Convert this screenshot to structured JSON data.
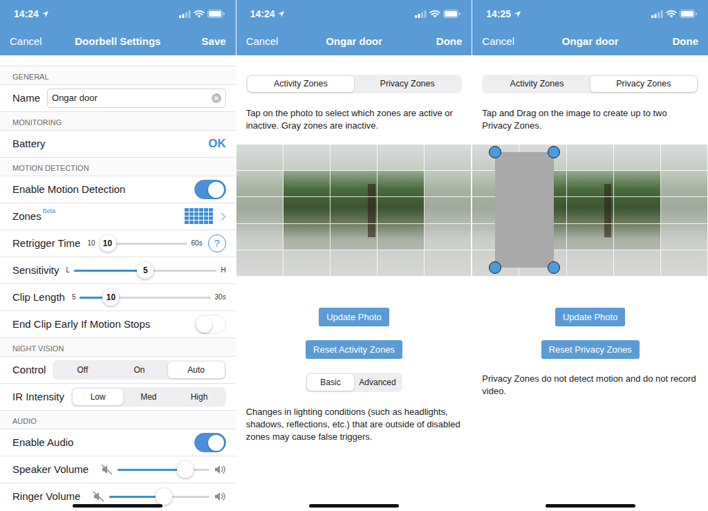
{
  "screens": [
    {
      "status_bar": {
        "time": "14:24"
      },
      "nav": {
        "left": "Cancel",
        "title": "Doorbell Settings",
        "right": "Save"
      },
      "sections": [
        {
          "header": "GENERAL",
          "rows": [
            {
              "kind": "field",
              "label": "Name",
              "value": "Ongar door"
            }
          ]
        },
        {
          "header": "MONITORING",
          "rows": [
            {
              "kind": "status",
              "label": "Battery",
              "value": "OK"
            }
          ]
        },
        {
          "header": "MOTION DETECTION",
          "rows": [
            {
              "kind": "toggle",
              "label": "Enable Motion Detection",
              "on": true
            },
            {
              "kind": "link",
              "label": "Zones",
              "badge": "Beta"
            },
            {
              "kind": "slider",
              "label": "Retrigger Time",
              "min": "10",
              "max": "60s",
              "reading": "10",
              "level": 0,
              "help": "?"
            },
            {
              "kind": "slider",
              "label": "Sensitivity",
              "min": "L",
              "max": "H",
              "reading": "5",
              "level": 0.5
            },
            {
              "kind": "slider",
              "label": "Clip Length",
              "min": "5",
              "max": "30s",
              "reading": "10",
              "level": 0.2
            },
            {
              "kind": "toggle",
              "label": "End Clip Early If Motion Stops",
              "on": false
            }
          ]
        },
        {
          "header": "NIGHT VISION",
          "rows": [
            {
              "kind": "segmented",
              "label": "Control",
              "options": [
                {
                  "label": "Off",
                  "selected": false
                },
                {
                  "label": "On",
                  "selected": false
                },
                {
                  "label": "Auto",
                  "selected": true
                }
              ]
            },
            {
              "kind": "segmented",
              "label": "IR Intensity",
              "options": [
                {
                  "label": "Low",
                  "selected": true
                },
                {
                  "label": "Med",
                  "selected": false
                },
                {
                  "label": "High",
                  "selected": false
                }
              ]
            }
          ]
        },
        {
          "header": "AUDIO",
          "rows": [
            {
              "kind": "toggle",
              "label": "Enable Audio",
              "on": true
            },
            {
              "kind": "volume",
              "label": "Speaker Volume",
              "level": 0.79
            },
            {
              "kind": "volume",
              "label": "Ringer Volume",
              "level": 0.55
            }
          ]
        }
      ]
    },
    {
      "status_bar": {
        "time": "14:24"
      },
      "nav": {
        "left": "Cancel",
        "title": "Ongar door",
        "right": "Done"
      },
      "tabs": [
        {
          "label": "Activity Zones",
          "selected": true
        },
        {
          "label": "Privacy Zones",
          "selected": false
        }
      ],
      "instruction": "Tap on the photo to select which zones are active or inactive. Gray zones are inactive.",
      "zones": [
        [
          false,
          false,
          false,
          false,
          false
        ],
        [
          false,
          true,
          true,
          true,
          false
        ],
        [
          false,
          true,
          true,
          true,
          false
        ],
        [
          false,
          true,
          true,
          true,
          false
        ],
        [
          false,
          false,
          false,
          false,
          false
        ]
      ],
      "privacy_zones": [],
      "buttons": [
        {
          "label": "Update Photo"
        },
        {
          "label": "Reset Activity Zones"
        }
      ],
      "modes": [
        {
          "label": "Basic",
          "selected": true
        },
        {
          "label": "Advanced",
          "selected": false
        }
      ],
      "note": "Changes in lighting conditions (such as headlights, shadows, reflections, etc.) that are outside of disabled zones may cause false triggers."
    },
    {
      "status_bar": {
        "time": "14:25"
      },
      "nav": {
        "left": "Cancel",
        "title": "Ongar door",
        "right": "Done"
      },
      "tabs": [
        {
          "label": "Activity Zones",
          "selected": false
        },
        {
          "label": "Privacy Zones",
          "selected": true
        }
      ],
      "instruction": "Tap and Drag on the image to create up to two Privacy Zones.",
      "zones": [
        [
          false,
          false,
          false,
          false,
          false
        ],
        [
          false,
          true,
          true,
          true,
          false
        ],
        [
          false,
          true,
          true,
          true,
          false
        ],
        [
          false,
          true,
          true,
          true,
          false
        ],
        [
          false,
          false,
          false,
          false,
          false
        ]
      ],
      "privacy_zones": [
        {
          "selected": true
        }
      ],
      "buttons": [
        {
          "label": "Update Photo"
        },
        {
          "label": "Reset Privacy Zones"
        }
      ],
      "note": "Privacy Zones do not detect motion and do not record video."
    }
  ]
}
